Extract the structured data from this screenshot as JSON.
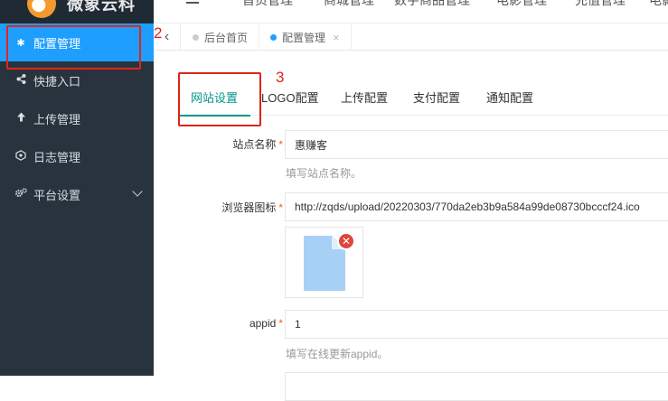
{
  "app": {
    "logo_text": "微象云科"
  },
  "top_nav": [
    {
      "label": "首页管理"
    },
    {
      "label": "商城管理"
    },
    {
      "label": "数字商品管理"
    },
    {
      "label": "电影管理"
    },
    {
      "label": "充值管理"
    },
    {
      "label": "电影"
    }
  ],
  "sidebar": {
    "items": [
      {
        "label": "配置管理",
        "icon": "asterisk-icon",
        "active": true
      },
      {
        "label": "快捷入口",
        "icon": "share-icon"
      },
      {
        "label": "上传管理",
        "icon": "arrow-up-icon"
      },
      {
        "label": "日志管理",
        "icon": "log-icon"
      },
      {
        "label": "平台设置",
        "icon": "gears-icon",
        "expandable": true
      }
    ]
  },
  "page_tabs": [
    {
      "label": "后台首页",
      "active": false
    },
    {
      "label": "配置管理",
      "active": true,
      "close": "×"
    }
  ],
  "tab_nav": {
    "prev": "‹"
  },
  "config_tabs": [
    {
      "label": "网站设置",
      "active": true
    },
    {
      "label": "LOGO配置"
    },
    {
      "label": "上传配置"
    },
    {
      "label": "支付配置"
    },
    {
      "label": "通知配置"
    }
  ],
  "form": {
    "site_name": {
      "label": "站点名称",
      "required": "*",
      "value": "惠赚客",
      "help": "填写站点名称。"
    },
    "favicon": {
      "label": "浏览器图标",
      "required": "*",
      "value": "http://zqds/upload/20220303/770da2eb3b9a584a99de08730bcccf24.ico",
      "remove": "✕"
    },
    "appid": {
      "label": "appid",
      "required": "*",
      "value": "1",
      "help": "填写在线更新appid。"
    }
  },
  "annotations": [
    {
      "label": "2"
    },
    {
      "label": "3"
    }
  ],
  "colors": {
    "sidebar_bg": "#28333e",
    "active_blue": "#1e9fff",
    "teal": "#009688",
    "annotation_red": "#e0241b"
  }
}
